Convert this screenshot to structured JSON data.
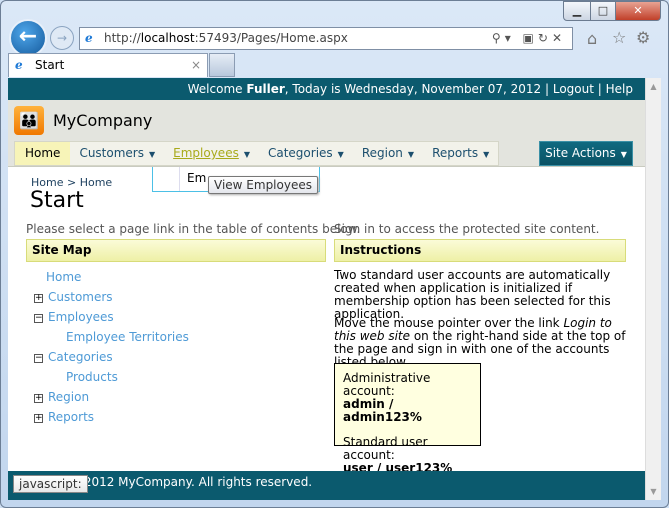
{
  "browser": {
    "url_prefix": "http://",
    "url_host": "localhost",
    "url_rest": ":57493/Pages/Home.aspx",
    "tab_title": "Start"
  },
  "header": {
    "welcome": "Welcome",
    "user": "Fuller",
    "date_text": ", Today is Wednesday, November 07, 2012",
    "sep": "|",
    "logout": "Logout",
    "help": "Help"
  },
  "brand": {
    "name": "MyCompany"
  },
  "menu": {
    "items": [
      "Home",
      "Customers",
      "Employees",
      "Categories",
      "Region",
      "Reports"
    ],
    "site_actions": "Site Actions"
  },
  "dropdown": {
    "item": "Em",
    "tooltip": "View Employees"
  },
  "breadcrumb": {
    "home": "Home",
    "sep": ">",
    "current": "Home"
  },
  "page_title": "Start",
  "left": {
    "note": "Please select a page link in the table of contents below.",
    "header": "Site Map",
    "tree": [
      "Home",
      "Customers",
      "Employees",
      "Employee Territories",
      "Categories",
      "Products",
      "Region",
      "Reports"
    ]
  },
  "right": {
    "note": "Sign in to access the protected site content.",
    "header": "Instructions",
    "p1": "Two standard user accounts are automatically created when application is initialized if membership option has been selected for this application.",
    "p2a": "Move the mouse pointer over the link ",
    "p2link": "Login to this web site",
    "p2b": " on the right-hand side at the top of the page and sign in with one of the accounts listed below.",
    "admin_label": "Administrative account:",
    "admin_cred": "admin / admin123%",
    "user_label": "Standard user account:",
    "user_cred": "user / user123%"
  },
  "footer": {
    "text": "© 2012 MyCompany. All rights reserved.",
    "status_tip": "javascript:"
  }
}
